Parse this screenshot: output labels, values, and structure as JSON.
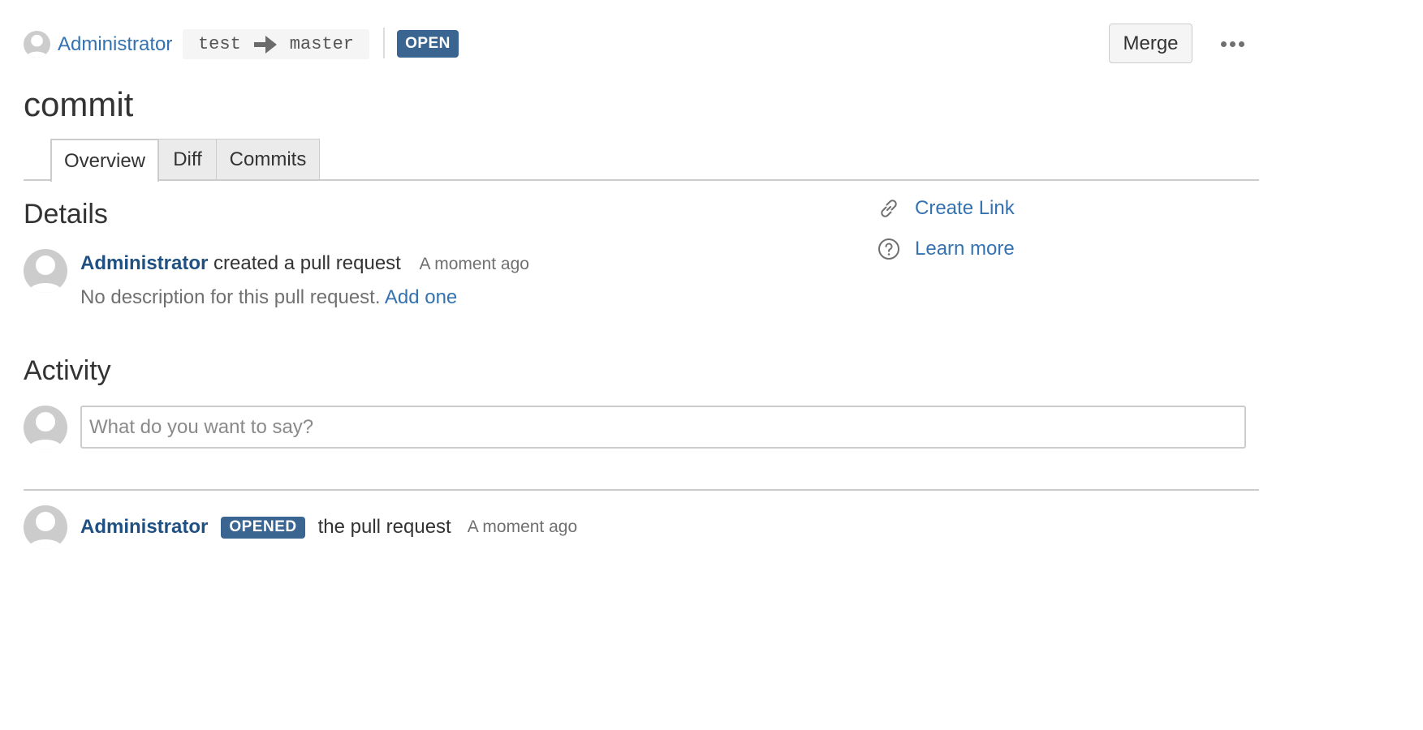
{
  "header": {
    "author": "Administrator",
    "source_branch": "test",
    "target_branch": "master",
    "status": "OPEN",
    "merge_label": "Merge"
  },
  "pull_request": {
    "title": "commit"
  },
  "tabs": [
    {
      "label": "Overview",
      "active": true
    },
    {
      "label": "Diff",
      "active": false
    },
    {
      "label": "Commits",
      "active": false
    }
  ],
  "details": {
    "heading": "Details",
    "author": "Administrator",
    "action": "created a pull request",
    "time": "A moment ago",
    "description": "No description for this pull request.",
    "add_link": "Add one"
  },
  "side_links": [
    {
      "label": "Create Link",
      "icon": "link-icon"
    },
    {
      "label": "Learn more",
      "icon": "question-icon"
    }
  ],
  "activity": {
    "heading": "Activity",
    "comment_placeholder": "What do you want to say?",
    "events": [
      {
        "author": "Administrator",
        "badge": "OPENED",
        "text": "the pull request",
        "time": "A moment ago"
      }
    ]
  },
  "colors": {
    "link": "#205081",
    "link_light": "#3572b0",
    "lozenge": "#3b6591",
    "muted": "#707070",
    "border": "#cccccc"
  }
}
